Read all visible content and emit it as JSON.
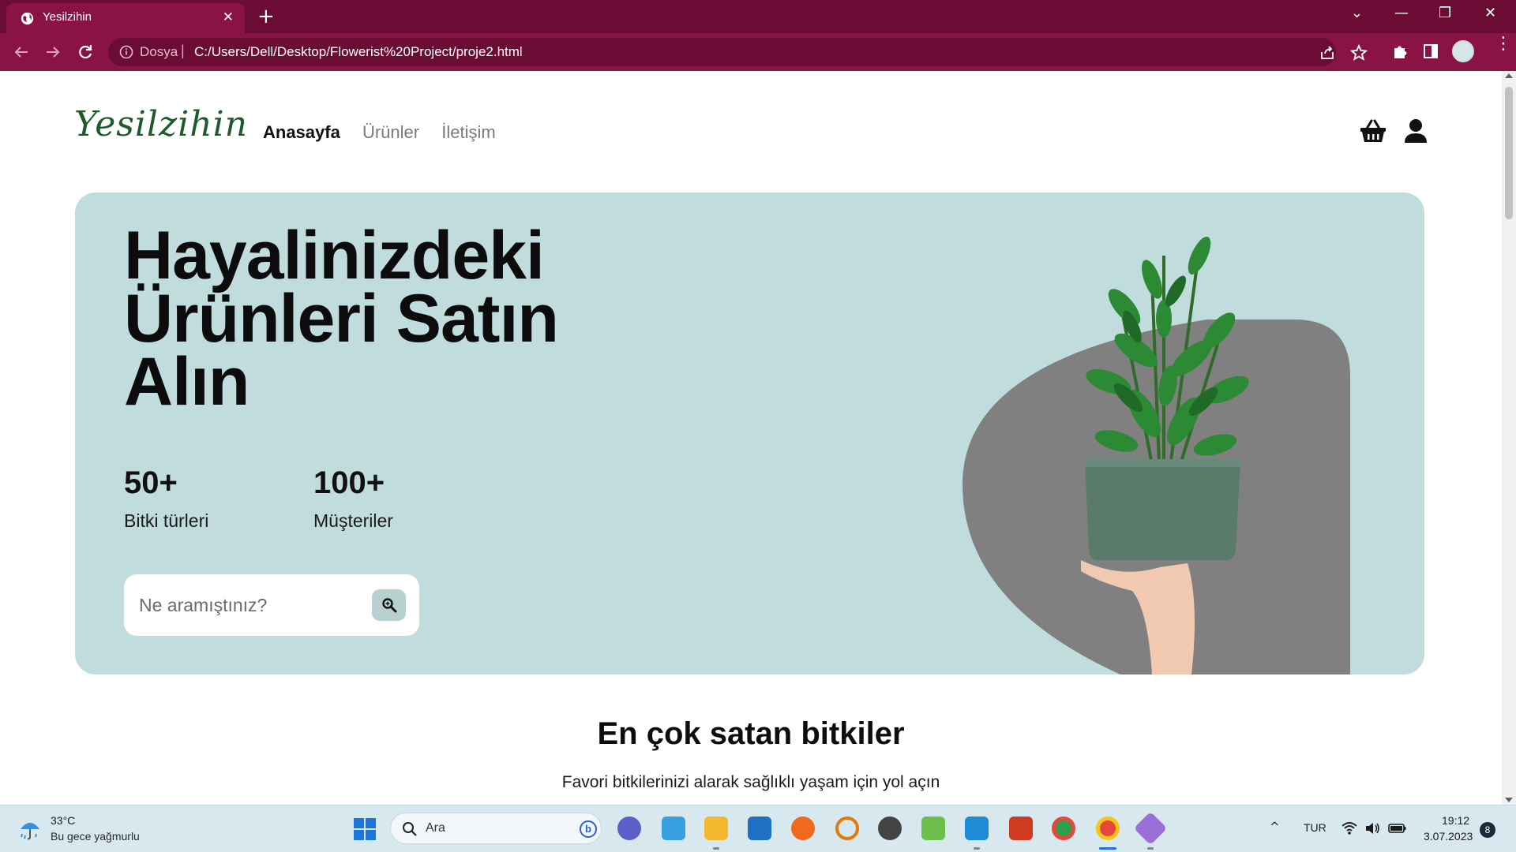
{
  "browser": {
    "tab_title": "Yesilzihin",
    "tab_close": "✕",
    "new_tab": "+",
    "scheme_label": "Dosya",
    "separator": "|",
    "url": "C:/Users/Dell/Desktop/Flowerist%20Project/proje2.html",
    "window_controls": {
      "dropdown": "⌄",
      "minimize": "—",
      "restore": "❐",
      "close": "✕"
    },
    "menu": "⋮",
    "theme_color": "#8a1346"
  },
  "site": {
    "logo": "Yesilzihin",
    "nav": [
      {
        "label": "Anasayfa",
        "active": true
      },
      {
        "label": "Ürünler",
        "active": false
      },
      {
        "label": "İletişim",
        "active": false
      }
    ]
  },
  "hero": {
    "title_lines": [
      "Hayalinizdeki",
      "Ürünleri Satın",
      "Alın"
    ],
    "stats": [
      {
        "value": "50+",
        "label": "Bitki türleri"
      },
      {
        "value": "100+",
        "label": "Müşteriler"
      }
    ],
    "search_placeholder": "Ne aramıştınız?",
    "bg_color": "#c1dcdc"
  },
  "section": {
    "title": "En çok satan bitkiler",
    "subtitle": "Favori bitkilerinizi alarak sağlıklı yaşam için yol açın"
  },
  "taskbar": {
    "weather_temp": "33°C",
    "weather_desc": "Bu gece yağmurlu",
    "search_label": "Ara",
    "bing_label": "b",
    "tray_chevron": "^",
    "language": "TUR",
    "time": "19:12",
    "date": "3.07.2023",
    "notifications": "8"
  }
}
